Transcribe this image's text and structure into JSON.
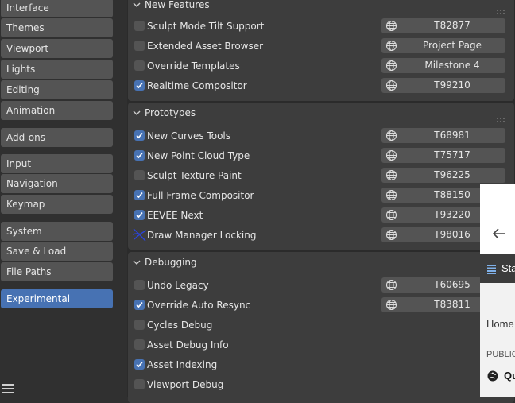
{
  "sidebar": {
    "items": [
      {
        "label": "Interface",
        "active": false
      },
      {
        "label": "Themes",
        "active": false
      },
      {
        "label": "Viewport",
        "active": false
      },
      {
        "label": "Lights",
        "active": false
      },
      {
        "label": "Editing",
        "active": false
      },
      {
        "label": "Animation",
        "active": false
      },
      {
        "label": "Add-ons",
        "active": false
      },
      {
        "label": "Input",
        "active": false
      },
      {
        "label": "Navigation",
        "active": false
      },
      {
        "label": "Keymap",
        "active": false
      },
      {
        "label": "System",
        "active": false
      },
      {
        "label": "Save & Load",
        "active": false
      },
      {
        "label": "File Paths",
        "active": false
      },
      {
        "label": "Experimental",
        "active": true
      }
    ]
  },
  "panels": {
    "new_features": {
      "title": "New Features",
      "rows": [
        {
          "label": "Sculpt Mode Tilt Support",
          "checked": false,
          "link": "T82877"
        },
        {
          "label": "Extended Asset Browser",
          "checked": false,
          "link": "Project Page"
        },
        {
          "label": "Override Templates",
          "checked": false,
          "link": "Milestone 4"
        },
        {
          "label": "Realtime Compositor",
          "checked": true,
          "link": "T99210"
        }
      ]
    },
    "prototypes": {
      "title": "Prototypes",
      "rows": [
        {
          "label": "New Curves Tools",
          "checked": true,
          "link": "T68981"
        },
        {
          "label": "New Point Cloud Type",
          "checked": true,
          "link": "T75717"
        },
        {
          "label": "Sculpt Texture Paint",
          "checked": false,
          "link": "T96225"
        },
        {
          "label": "Full Frame Compositor",
          "checked": true,
          "link": "T88150"
        },
        {
          "label": "EEVEE Next",
          "checked": true,
          "link": "T93220"
        },
        {
          "label": "Draw Manager Locking",
          "checked": false,
          "link": "T98016"
        }
      ]
    },
    "debugging": {
      "title": "Debugging",
      "rows": [
        {
          "label": "Undo Legacy",
          "checked": false,
          "link": "T60695"
        },
        {
          "label": "Override Auto Resync",
          "checked": true,
          "link": "T83811"
        },
        {
          "label": "Cycles Debug",
          "checked": false,
          "link": ""
        },
        {
          "label": "Asset Debug Info",
          "checked": false,
          "link": ""
        },
        {
          "label": "Asset Indexing",
          "checked": true,
          "link": ""
        },
        {
          "label": "Viewport Debug",
          "checked": false,
          "link": ""
        }
      ]
    }
  },
  "overlay": {
    "nav_tab": "Sta",
    "breadcrumb": "Home",
    "section": "PUBLIC",
    "item": "Qu"
  },
  "colors": {
    "accent": "#4772b3",
    "background": "#303030",
    "panel": "#3d3d3d",
    "button": "#545454"
  }
}
